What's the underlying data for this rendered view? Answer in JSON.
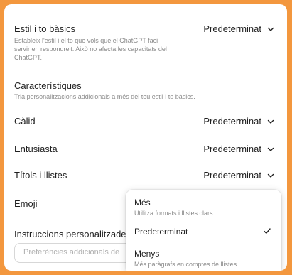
{
  "settings": {
    "style": {
      "title": "Estil i to bàsics",
      "desc_line1": "Estableix l'estil i el to que vols que el ChatGPT faci",
      "desc_line2": "servir en respondre't. Això no afecta les capacitats del",
      "desc_line3": "ChatGPT.",
      "value": "Predeterminat"
    },
    "characteristics": {
      "title": "Característiques",
      "desc": "Tria personalitzacions addicionals a més del teu estil i to bàsics."
    },
    "calid": {
      "label": "Càlid",
      "value": "Predeterminat"
    },
    "entusiasta": {
      "label": "Entusiasta",
      "value": "Predeterminat"
    },
    "titols": {
      "label": "Títols i llistes",
      "value": "Predeterminat"
    },
    "emoji": {
      "label": "Emoji"
    },
    "custom_instructions": {
      "label": "Instruccions personalitzades",
      "placeholder": "Preferències addicionals de"
    }
  },
  "dropdown": {
    "options": [
      {
        "label": "Més",
        "desc": "Utilitza formats i llistes clars"
      },
      {
        "label": "Predeterminat",
        "desc": "",
        "selected": true
      },
      {
        "label": "Menys",
        "desc": "Més paràgrafs en comptes de llistes"
      }
    ]
  },
  "colors": {
    "background": "#f3973e",
    "panel": "#ffffff",
    "muted_text": "#8a8a8a"
  },
  "icons": {
    "chevron": "chevron-down-icon",
    "check": "check-icon"
  }
}
